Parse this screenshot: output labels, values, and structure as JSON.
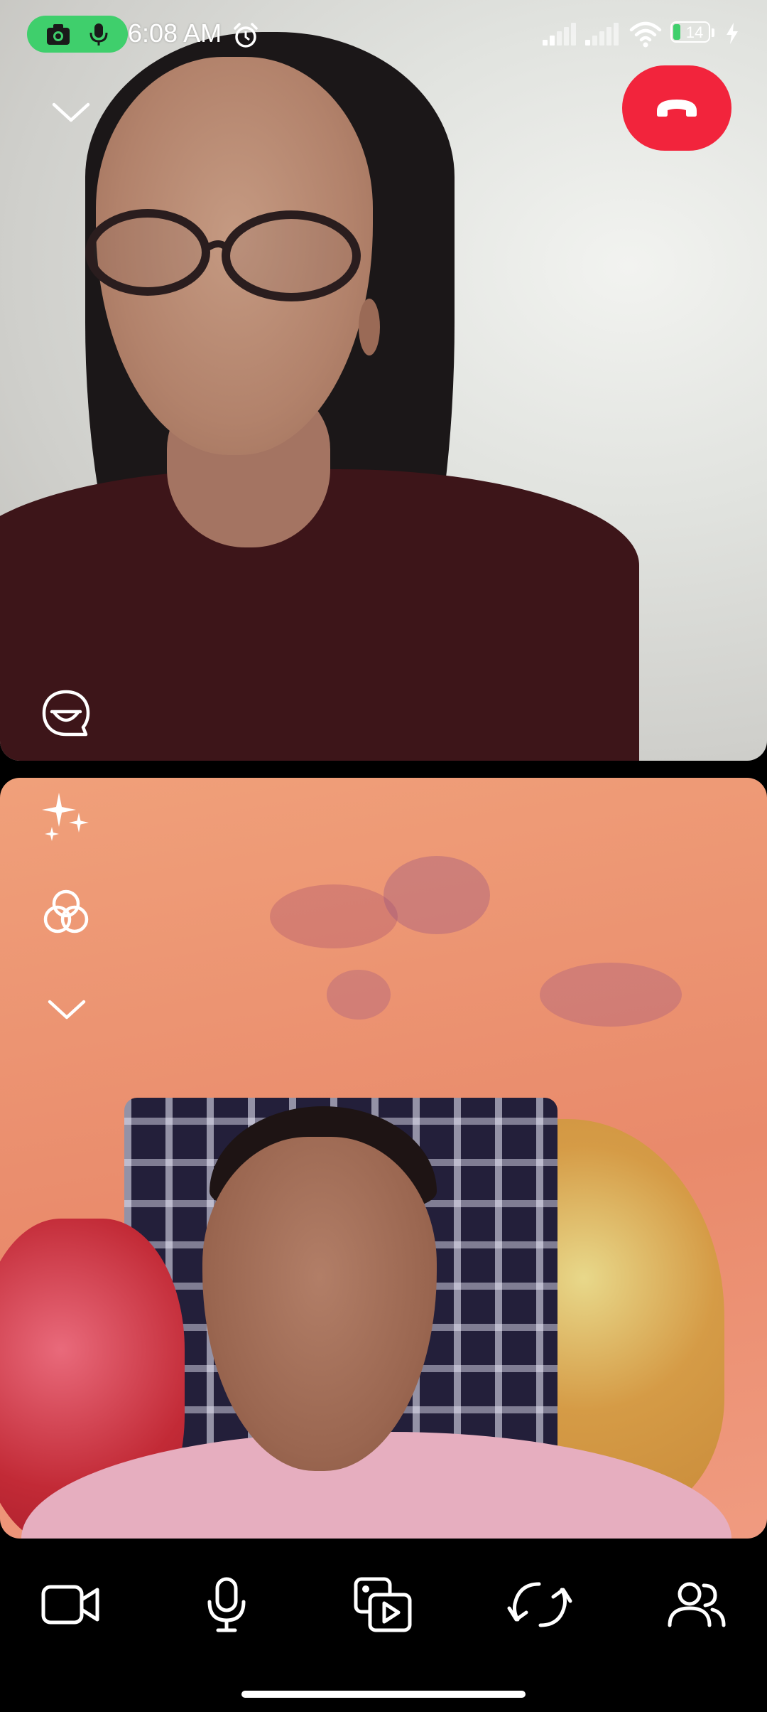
{
  "status_bar": {
    "time": "6:08 AM",
    "battery_level": "14",
    "recording_indicators": [
      "camera-icon",
      "microphone-icon"
    ],
    "icons": [
      "alarm-icon",
      "signal-icon",
      "signal-icon",
      "wifi-icon",
      "battery-icon",
      "charging-icon"
    ]
  },
  "call": {
    "controls_top": [
      "chevron-down-icon",
      "end-call-icon"
    ],
    "controls_side": [
      "chat-icon",
      "sparkles-icon",
      "filters-icon",
      "chevron-down-icon"
    ]
  },
  "toolbar": {
    "buttons": [
      "video-camera-icon",
      "microphone-icon",
      "share-media-icon",
      "flip-camera-icon",
      "participants-icon"
    ]
  },
  "colors": {
    "end_call": "#f2243c",
    "recording_pill": "#3fcf6c",
    "background": "#000000"
  }
}
